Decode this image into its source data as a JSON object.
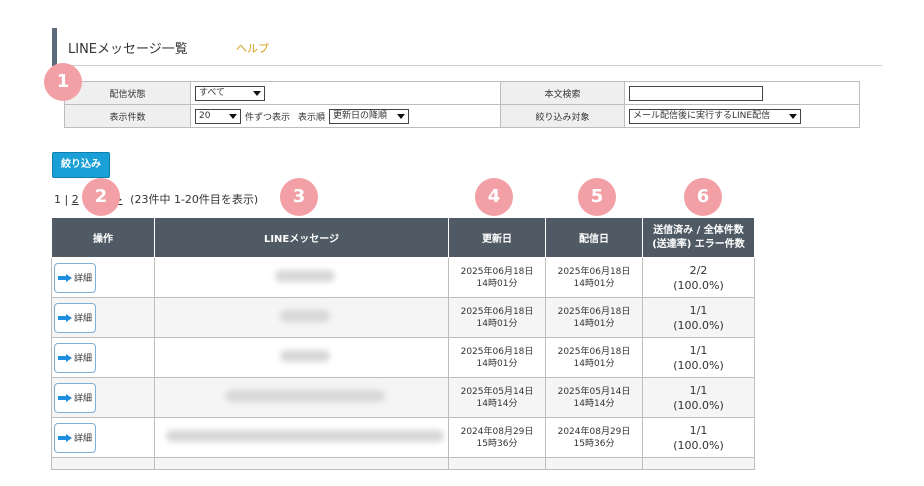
{
  "header": {
    "title": "LINEメッセージ一覧",
    "help": "ヘルプ"
  },
  "filters": {
    "status_label": "配信状態",
    "status_value": "すべて",
    "search_label": "本文検索",
    "search_value": "",
    "per_page_label": "表示件数",
    "per_page_value": "20",
    "per_page_suffix": "件ずつ表示",
    "sort_label": "表示順",
    "sort_value": "更新日の降順",
    "target_label": "絞り込み対象",
    "target_value": "メール配信後に実行するLINE配信"
  },
  "filter_button": "絞り込み",
  "pager": {
    "page1": "1",
    "sep": "|",
    "page2": "2",
    "next": ">>",
    "summary": "(23件中 1-20件目を表示)"
  },
  "table": {
    "headers": {
      "action": "操作",
      "message": "LINEメッセージ",
      "updated": "更新日",
      "sent": "配信日",
      "count_line1": "送信済み / 全体件数",
      "count_line2": "(送達率) エラー件数"
    },
    "detail_label": "詳細",
    "rows": [
      {
        "updated_date": "2025年06月18日",
        "updated_time": "14時01分",
        "sent_date": "2025年06月18日",
        "sent_time": "14時01分",
        "count": "2/2",
        "rate": "(100.0%)"
      },
      {
        "updated_date": "2025年06月18日",
        "updated_time": "14時01分",
        "sent_date": "2025年06月18日",
        "sent_time": "14時01分",
        "count": "1/1",
        "rate": "(100.0%)"
      },
      {
        "updated_date": "2025年06月18日",
        "updated_time": "14時01分",
        "sent_date": "2025年06月18日",
        "sent_time": "14時01分",
        "count": "1/1",
        "rate": "(100.0%)"
      },
      {
        "updated_date": "2025年05月14日",
        "updated_time": "14時14分",
        "sent_date": "2025年05月14日",
        "sent_time": "14時14分",
        "count": "1/1",
        "rate": "(100.0%)"
      },
      {
        "updated_date": "2024年08月29日",
        "updated_time": "15時36分",
        "sent_date": "2024年08月29日",
        "sent_time": "15時36分",
        "count": "1/1",
        "rate": "(100.0%)"
      }
    ]
  },
  "badges": [
    "1",
    "2",
    "3",
    "4",
    "5",
    "6"
  ],
  "colors": {
    "header_bg": "#4f5a64",
    "button_bg": "#1aa0d6",
    "badge": "#f2a0a5",
    "help": "#d4a017"
  }
}
